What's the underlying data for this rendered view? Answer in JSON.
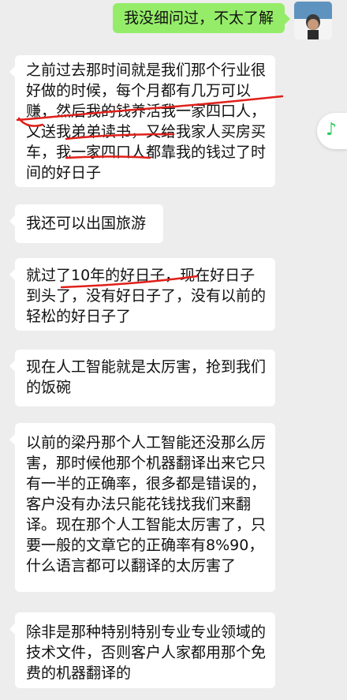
{
  "messages": [
    {
      "side": "out",
      "text": "我没细问过，不太了解"
    },
    {
      "side": "in",
      "text": "之前过去那时间就是我们那个行业很好做的时候，每个月都有几万可以赚，然后我的钱养活我一家四口人，又送我弟弟读书，又给我家人买房买车，我一家四口人都靠我的钱过了时间的好日子"
    },
    {
      "side": "in",
      "text": "我还可以出国旅游"
    },
    {
      "side": "in",
      "text": "就过了10年的好日子，现在好日子到头了，没有好日子了，没有以前的轻松的好日子了"
    },
    {
      "side": "in",
      "text": "现在人工智能就是太厉害，抢到我们的饭碗"
    },
    {
      "side": "in",
      "text": "以前的梁丹那个人工智能还没那么厉害，那时候他那个机器翻译出来它只有一半的正确率，很多都是错误的，客户没有办法只能花钱找我们来翻译。现在那个人工智能太厉害了，只要一般的文章它的正确率有8%90，什么语言都可以翻译的太厉害了"
    },
    {
      "side": "in",
      "text": "除非是那种特别特别专业专业领域的技术文件，否则客户人家都用那个免费的机器翻译的"
    }
  ],
  "colors": {
    "background": "#ededed",
    "bubble_in": "#ffffff",
    "bubble_out": "#95ec69",
    "annotation": "#e0201a",
    "music_icon": "#2ec95f"
  },
  "icons": {
    "floating": "music-note-icon",
    "avatar": "user-avatar"
  }
}
